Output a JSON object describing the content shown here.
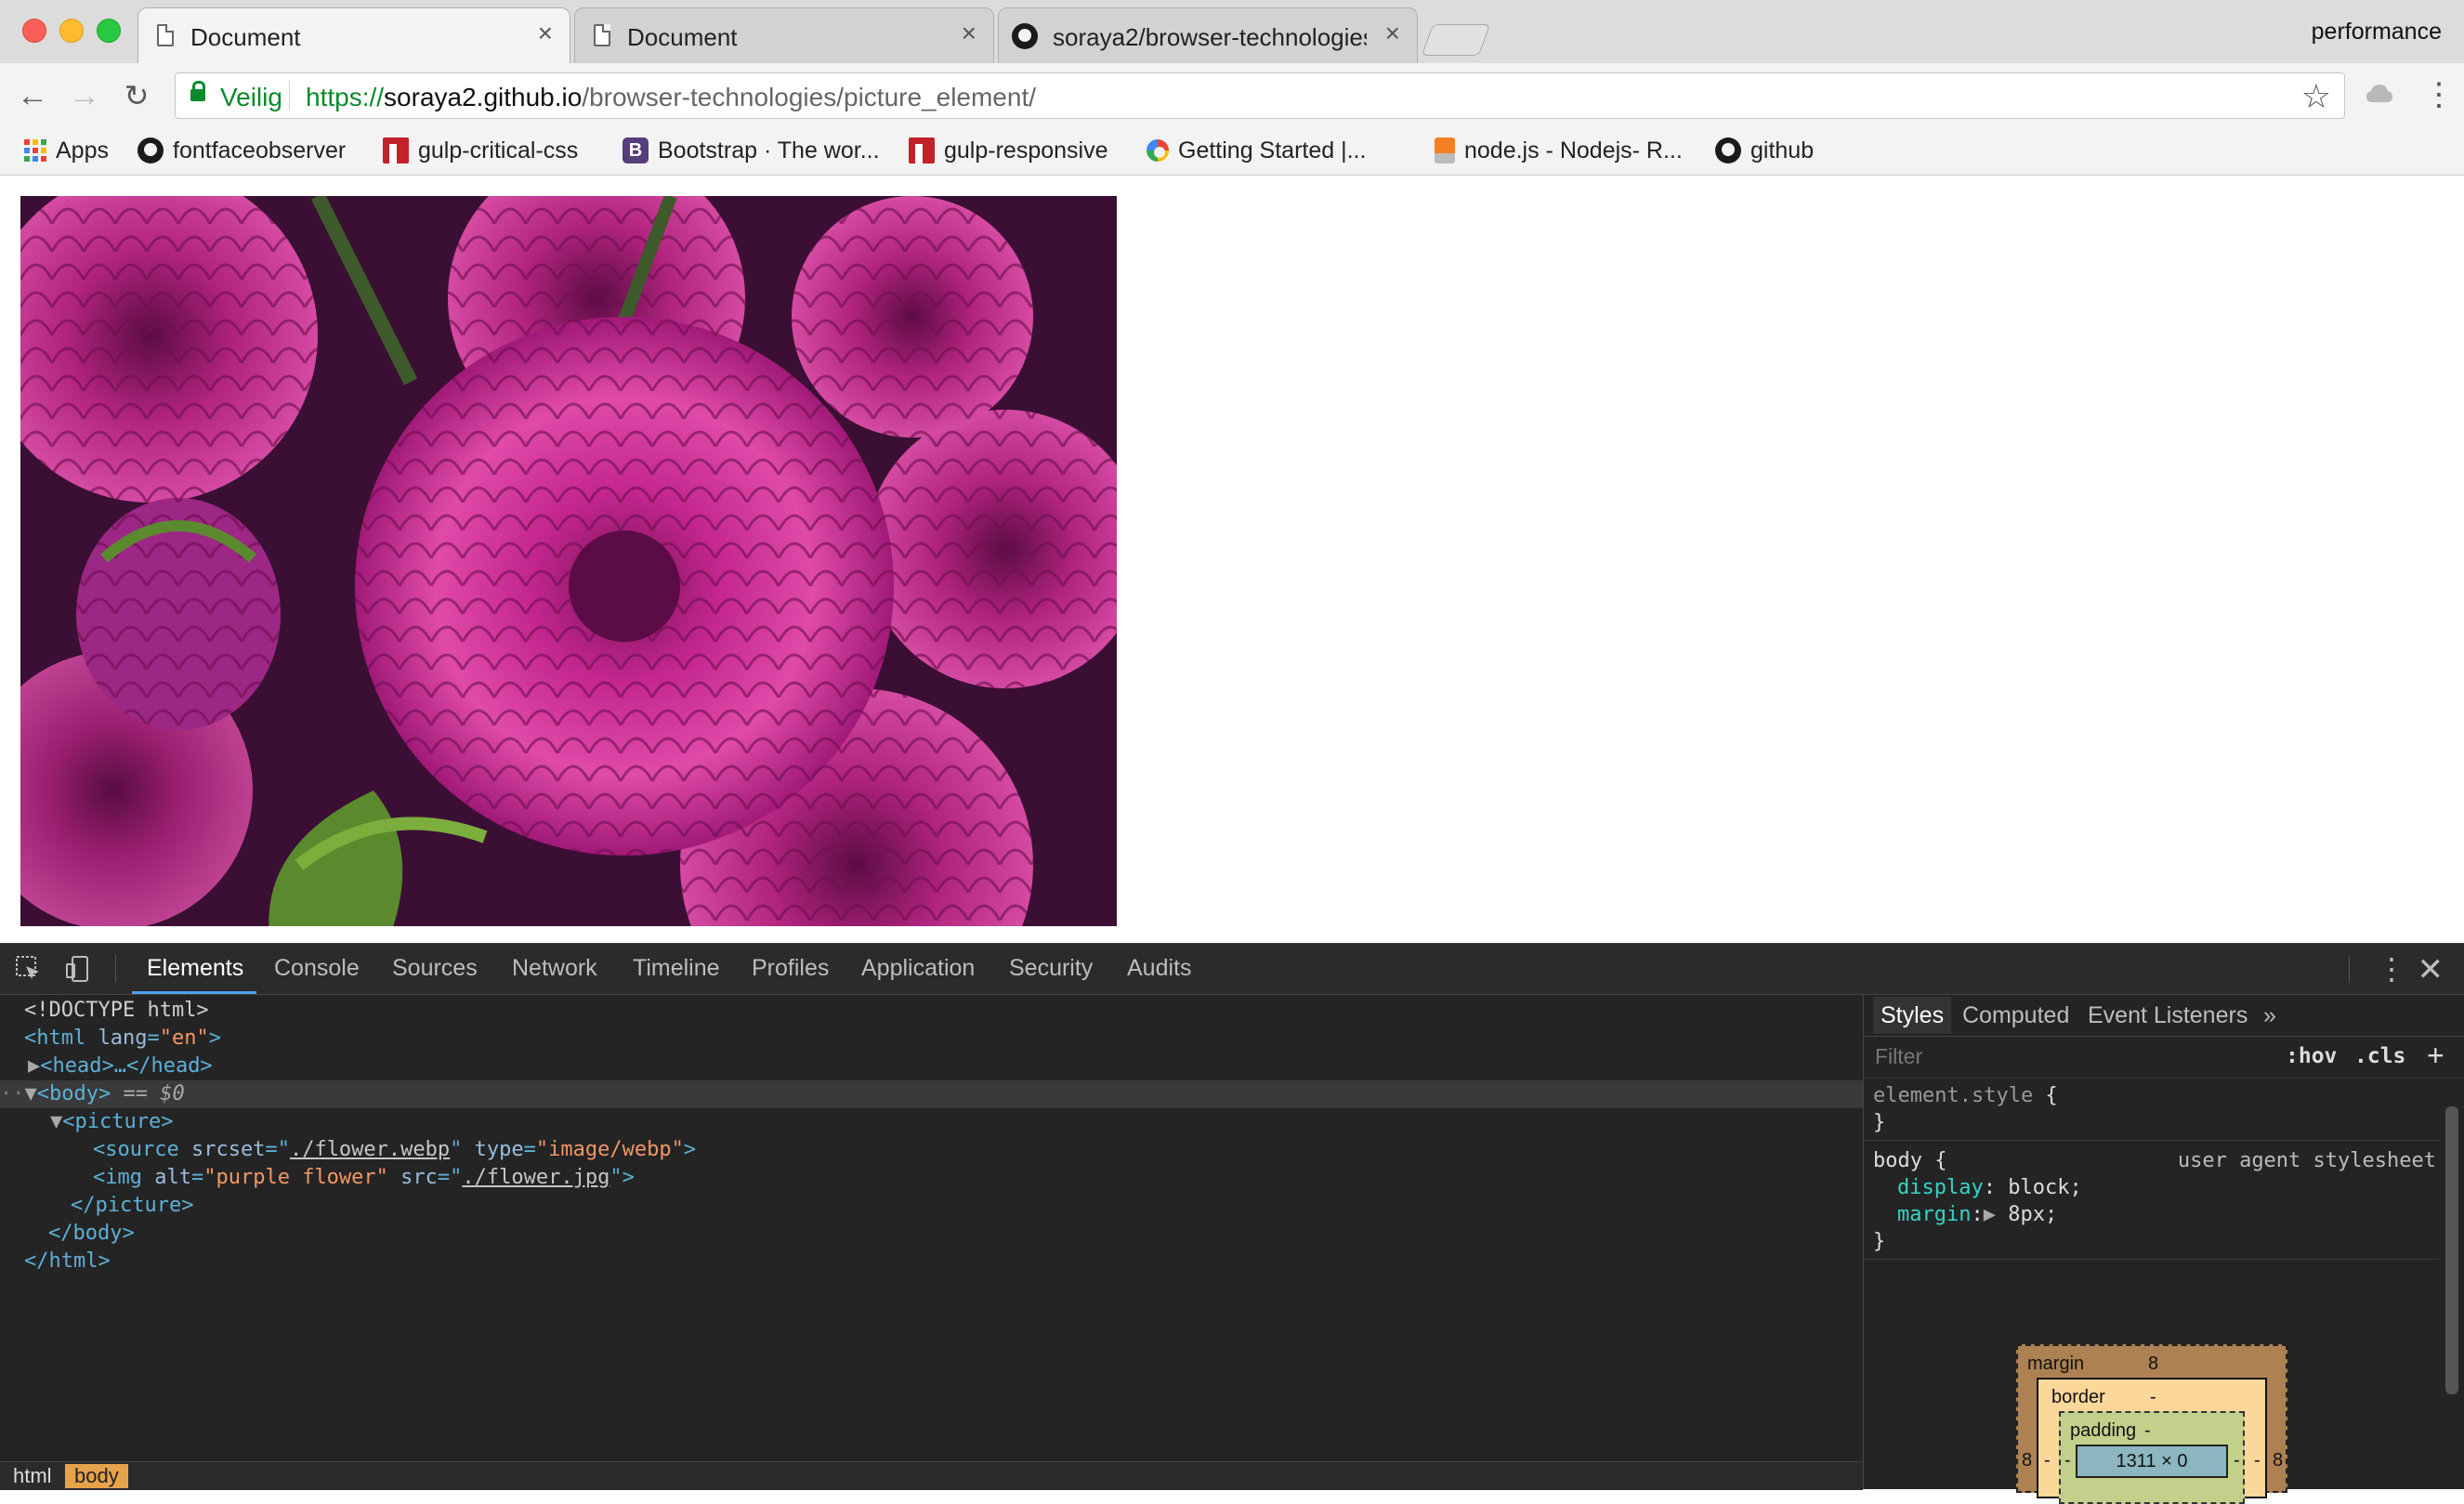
{
  "tabs": [
    {
      "title": "Document",
      "icon": "document-icon",
      "active": true
    },
    {
      "title": "Document",
      "icon": "document-icon",
      "active": false
    },
    {
      "title": "soraya2/browser-technologies",
      "icon": "github-icon",
      "active": false
    }
  ],
  "profile": "performance",
  "omnibox": {
    "secure_label": "Veilig",
    "url_scheme": "https://",
    "url_host": "soraya2.github.io",
    "url_path": "/browser-technologies/picture_element/"
  },
  "bookmarks": [
    {
      "label": "Apps",
      "icon": "apps-grid-icon"
    },
    {
      "label": "fontfaceobserver",
      "icon": "github-icon"
    },
    {
      "label": "gulp-critical-css",
      "icon": "npm-icon"
    },
    {
      "label": "Bootstrap · The wor...",
      "icon": "bootstrap-icon"
    },
    {
      "label": "gulp-responsive",
      "icon": "npm-icon"
    },
    {
      "label": "Getting Started  |...",
      "icon": "google-icon"
    },
    {
      "label": "node.js - Nodejs- R...",
      "icon": "stackoverflow-icon"
    },
    {
      "label": "github",
      "icon": "github-icon"
    }
  ],
  "page": {
    "image_alt": "purple flower"
  },
  "devtools": {
    "tabs": [
      "Elements",
      "Console",
      "Sources",
      "Network",
      "Timeline",
      "Profiles",
      "Application",
      "Security",
      "Audits"
    ],
    "active_tab": "Elements",
    "dom": {
      "doctype": "<!DOCTYPE html>",
      "html_open_tag": "<html",
      "html_lang_attr": "lang",
      "html_lang_val": "\"en\"",
      "head_collapsed": "<head>…</head>",
      "body_tag": "<body>",
      "body_ref": "== $0",
      "picture_tag": "<picture>",
      "source_tag": "<source",
      "source_srcset_attr": "srcset",
      "source_srcset_val": "./flower.webp",
      "source_type_attr": "type",
      "source_type_val": "\"image/webp\"",
      "img_tag": "<img",
      "img_alt_attr": "alt",
      "img_alt_val": "\"purple flower\"",
      "img_src_attr": "src",
      "img_src_val": "./flower.jpg",
      "picture_close": "</picture>",
      "body_close": "</body>",
      "html_close": "</html>"
    },
    "breadcrumbs": [
      "html",
      "body"
    ],
    "sidebar": {
      "tabs": [
        "Styles",
        "Computed",
        "Event Listeners"
      ],
      "more": "»",
      "filter_placeholder": "Filter",
      "hov": ":hov",
      "cls": ".cls",
      "add": "+",
      "element_style_selector": "element.style",
      "body_selector": "body",
      "ua_label": "user agent stylesheet",
      "prop_display": "display",
      "val_display": "block;",
      "prop_margin": "margin",
      "val_margin": "8px;",
      "box_model": {
        "margin_label": "margin",
        "margin_value": "8",
        "border_label": "border",
        "border_value": "-",
        "padding_label": "padding",
        "padding_value": "-",
        "content_size": "1311 × 0",
        "side_margin": "8",
        "side_dash": "-"
      }
    }
  }
}
